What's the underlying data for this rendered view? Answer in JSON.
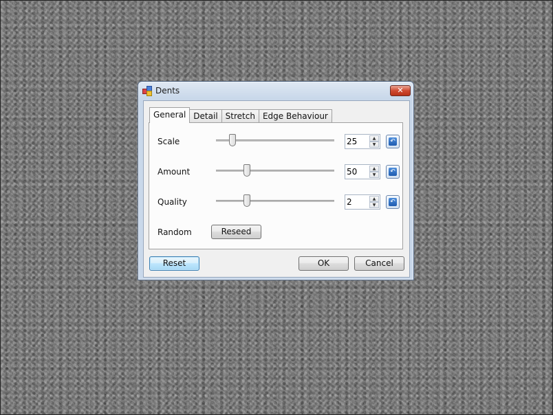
{
  "window": {
    "title": "Dents",
    "close_glyph": "✕"
  },
  "tabs": [
    {
      "label": "General",
      "active": true
    },
    {
      "label": "Detail",
      "active": false
    },
    {
      "label": "Stretch",
      "active": false
    },
    {
      "label": "Edge Behaviour",
      "active": false
    }
  ],
  "general": {
    "scale": {
      "label": "Scale",
      "value": "25",
      "slider_fraction": 0.14
    },
    "amount": {
      "label": "Amount",
      "value": "50",
      "slider_fraction": 0.26
    },
    "quality": {
      "label": "Quality",
      "value": "2",
      "slider_fraction": 0.26
    },
    "random": {
      "label": "Random",
      "button": "Reseed"
    }
  },
  "buttons": {
    "reset": "Reset",
    "ok": "OK",
    "cancel": "Cancel"
  },
  "icons": {
    "app": "dents-app-icon",
    "reset_value": "reset-arrow-icon",
    "spin_up": "▲",
    "spin_down": "▼",
    "reset_glyph": "↶"
  }
}
